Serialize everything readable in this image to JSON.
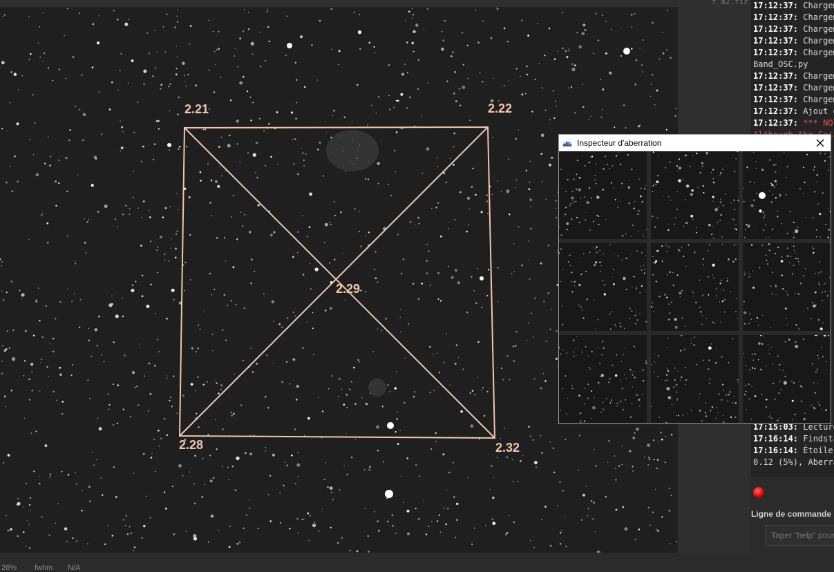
{
  "top_strip": {
    "partial_text": "f_a2.fic"
  },
  "fwhm_labels": {
    "top_left": "2.21",
    "top_right": "2.22",
    "center": "2.29",
    "bottom_left": "2.28",
    "bottom_right": "2.32"
  },
  "overlay_color": "#f2c6ae",
  "status_bar": {
    "zoom": "26%",
    "mode": "fwhm",
    "value": "N/A"
  },
  "console": {
    "lines": [
      {
        "time": "17:12:37:",
        "text": " Chargem",
        "style": "normal"
      },
      {
        "time": "17:12:37:",
        "text": " Chargem",
        "style": "normal"
      },
      {
        "time": "17:12:37:",
        "text": " Chargem",
        "style": "normal"
      },
      {
        "time": "17:12:37:",
        "text": " Chargem",
        "style": "normal"
      },
      {
        "time": "17:12:37:",
        "text": " Chargem",
        "style": "normal"
      },
      {
        "time": "",
        "text": "Band_OSC.py",
        "style": "normal"
      },
      {
        "time": "17:12:37:",
        "text": " Chargem",
        "style": "normal"
      },
      {
        "time": "17:12:37:",
        "text": " Chargem",
        "style": "normal"
      },
      {
        "time": "17:12:37:",
        "text": " Chargem",
        "style": "normal"
      },
      {
        "time": "17:12:37:",
        "text": " Ajout d",
        "style": "normal"
      },
      {
        "time": "17:12:37:",
        "text": " *** NOT",
        "style": "warn"
      },
      {
        "time": "",
        "text": "Although the Gaia",
        "style": "warn"
      }
    ],
    "lower_lines": [
      {
        "time": "17:15:03:",
        "text": " Lecture"
      },
      {
        "time": "17:16:14:",
        "text": " Findsta"
      },
      {
        "time": "17:16:14:",
        "text": " Étoiles"
      },
      {
        "time": "",
        "text": "0.12 (5%), Aberra"
      }
    ]
  },
  "command": {
    "title": "Ligne de commande",
    "placeholder": "Taper \"help\" pour"
  },
  "inspector": {
    "title": "Inspecteur d'aberration",
    "icon": "siril-icon",
    "close_icon": "close-icon"
  },
  "colors": {
    "record_button": "#cc0000",
    "warning_text": "#e05050"
  }
}
